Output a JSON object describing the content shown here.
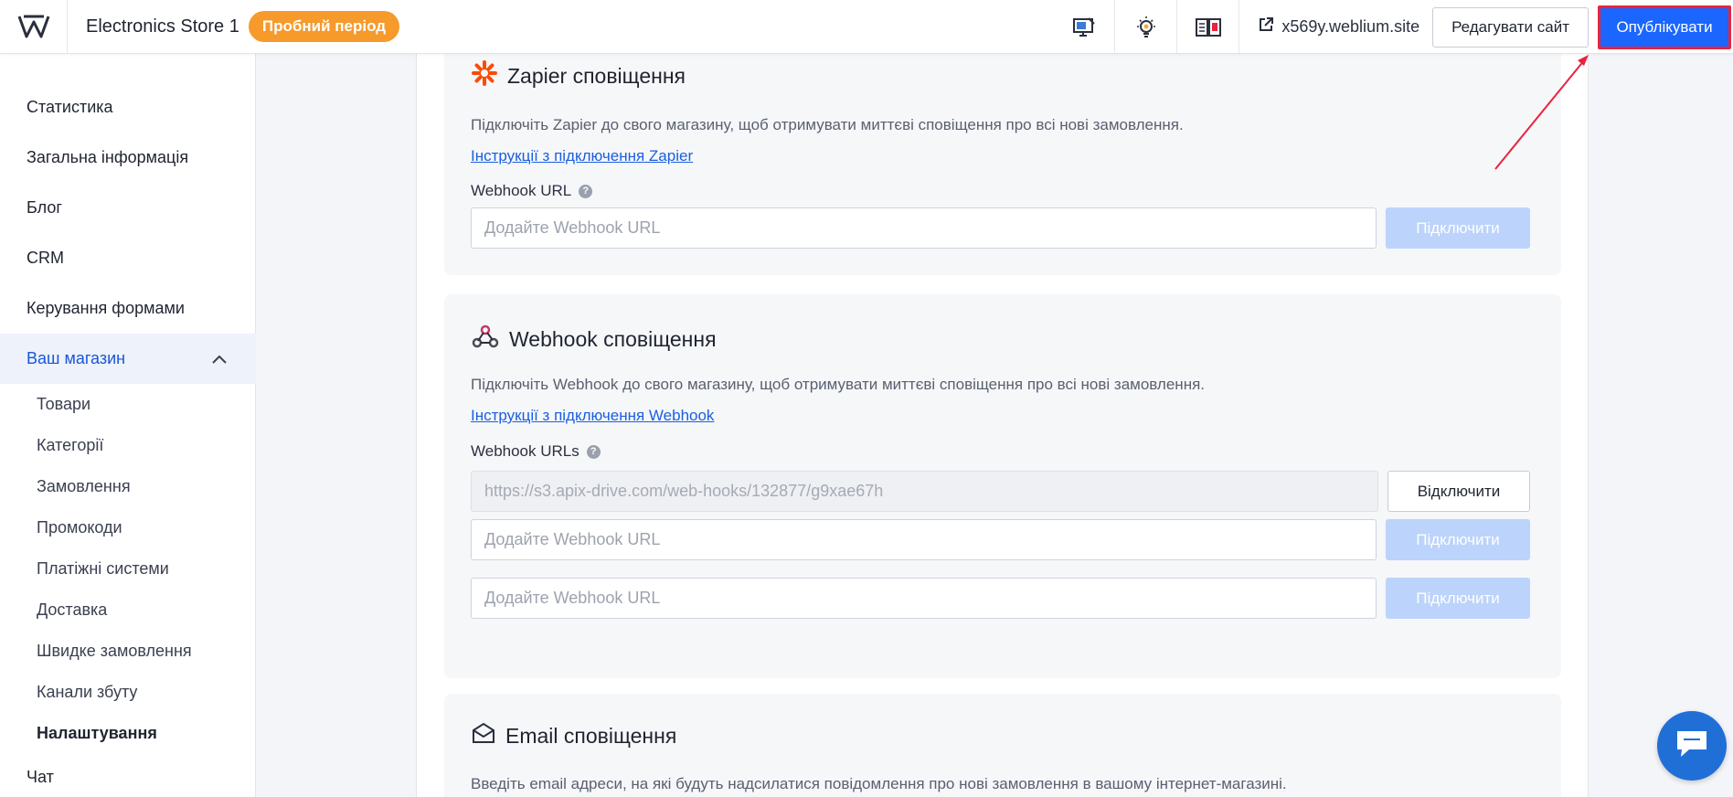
{
  "topbar": {
    "site_name": "Electronics Store 1",
    "trial_badge": "Пробний період",
    "site_link": "x569y.weblium.site",
    "edit_button": "Редагувати сайт",
    "publish_button": "Опублікувати",
    "icons": [
      "weblium-logo-icon",
      "monitor-edit-icon",
      "lightbulb-icon",
      "book-icon",
      "external-link-icon"
    ]
  },
  "sidebar": {
    "items": [
      {
        "label": "Статистика"
      },
      {
        "label": "Загальна інформація"
      },
      {
        "label": "Блог"
      },
      {
        "label": "CRM"
      },
      {
        "label": "Керування формами"
      }
    ],
    "active": {
      "label": "Ваш магазин"
    },
    "sub_items": [
      {
        "label": "Товари"
      },
      {
        "label": "Категорії"
      },
      {
        "label": "Замовлення"
      },
      {
        "label": "Промокоди"
      },
      {
        "label": "Платіжні системи"
      },
      {
        "label": "Доставка"
      },
      {
        "label": "Швидке замовлення"
      },
      {
        "label": "Канали збуту"
      },
      {
        "label": "Налаштування"
      }
    ],
    "bottom_item": {
      "label": "Чат"
    }
  },
  "zapier": {
    "title": "Zapier сповіщення",
    "description": "Підключіть Zapier до свого магазину, щоб отримувати миттєві сповіщення про всі нові замовлення.",
    "link": "Інструкції з підключення Zapier",
    "field_label": "Webhook URL",
    "placeholder": "Додайте Webhook URL",
    "connect_button": "Підключити"
  },
  "webhook": {
    "title": "Webhook сповіщення",
    "description": "Підключіть Webhook до свого магазину, щоб отримувати миттєві сповіщення про всі нові замовлення.",
    "link": "Інструкції з підключення Webhook",
    "field_label": "Webhook URLs",
    "connected_url": "https://s3.apix-drive.com/web-hooks/132877/g9xae67h",
    "disconnect_button": "Відключити",
    "placeholder": "Додайте Webhook URL",
    "connect_button": "Підключити"
  },
  "email": {
    "title": "Email сповіщення",
    "description": "Введіть email адреси, на які будуть надсилатися повідомлення про нові замовлення в вашому інтернет-магазині."
  },
  "colors": {
    "accent": "#1a66ff",
    "trial": "#f59a2b",
    "link": "#1a5fe0",
    "annotation": "#e8243c"
  }
}
